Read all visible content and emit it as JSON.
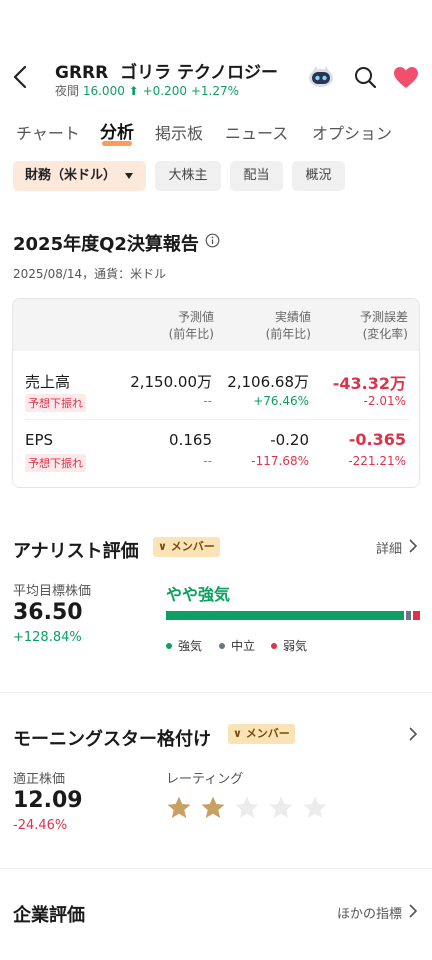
{
  "header": {
    "ticker": "GRRR",
    "company": "ゴリラ テクノロジー",
    "session_label": "夜間",
    "price": "16.000",
    "change": "+0.200",
    "change_pct": "+1.27%"
  },
  "tabs": [
    {
      "label": "チャート",
      "active": false
    },
    {
      "label": "分析",
      "active": true
    },
    {
      "label": "掲示板",
      "active": false
    },
    {
      "label": "ニュース",
      "active": false
    },
    {
      "label": "オプション",
      "active": false
    }
  ],
  "chips": [
    {
      "label": "財務（米ドル）",
      "active": true
    },
    {
      "label": "大株主",
      "active": false
    },
    {
      "label": "配当",
      "active": false
    },
    {
      "label": "概況",
      "active": false
    }
  ],
  "earnings": {
    "title": "2025年度Q2決算報告",
    "meta": "2025/08/14，通貨：米ドル",
    "columns": [
      {
        "line1": "予測値",
        "line2": "(前年比)"
      },
      {
        "line1": "実績値",
        "line2": "(前年比)"
      },
      {
        "line1": "予測誤差",
        "line2": "(変化率)"
      }
    ],
    "rows": [
      {
        "label": "売上高",
        "badge": "予想下振れ",
        "forecast": "2,150.00万",
        "forecast_yoy": "--",
        "actual": "2,106.68万",
        "actual_yoy": "+76.46%",
        "diff": "-43.32万",
        "diff_pct": "-2.01%"
      },
      {
        "label": "EPS",
        "badge": "予想下振れ",
        "forecast": "0.165",
        "forecast_yoy": "--",
        "actual": "-0.20",
        "actual_yoy": "-117.68%",
        "diff": "-0.365",
        "diff_pct": "-221.21%"
      }
    ]
  },
  "analyst": {
    "title": "アナリスト評価",
    "member_badge": "メンバー",
    "detail_link": "詳細",
    "target_label": "平均目標株価",
    "target_price": "36.50",
    "target_change": "+128.84%",
    "rating": "やや強気",
    "distribution": {
      "buy": 0.95,
      "hold": 0.02,
      "sell": 0.03
    },
    "legend": [
      "強気",
      "中立",
      "弱気"
    ],
    "colors": {
      "buy": "#0e9f62",
      "hold": "#6b7685",
      "sell": "#e0314b"
    }
  },
  "morningstar": {
    "title": "モーニングスター格付け",
    "member_badge": "メンバー",
    "fair_value_label": "適正株価",
    "fair_value": "12.09",
    "fair_value_change": "-24.46%",
    "rating_label": "レーティング",
    "stars_filled": 2,
    "stars_total": 5
  },
  "valuation": {
    "title": "企業評価",
    "link": "ほかの指標"
  },
  "colors": {
    "up": "#0e9f62",
    "down": "#e0314b",
    "accent": "#ff8a3d",
    "star": "#c9a063",
    "heart": "#f0506e"
  }
}
